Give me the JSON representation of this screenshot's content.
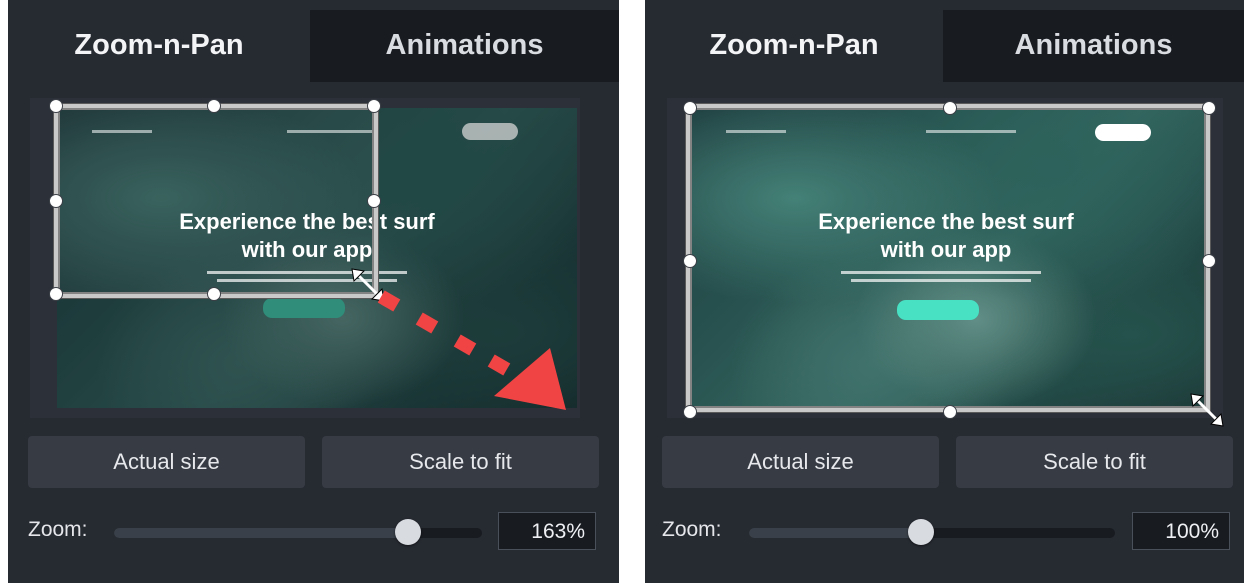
{
  "panels": [
    {
      "tabs": [
        {
          "label": "Zoom-n-Pan"
        },
        {
          "label": "Animations"
        }
      ],
      "preview": {
        "headline_line1": "Experience the best surf",
        "headline_line2": "with our app"
      },
      "buttons": {
        "actual_size": "Actual size",
        "scale_to_fit": "Scale to fit"
      },
      "zoom": {
        "label": "Zoom:",
        "value": "163%",
        "fraction": 0.8
      }
    },
    {
      "tabs": [
        {
          "label": "Zoom-n-Pan"
        },
        {
          "label": "Animations"
        }
      ],
      "preview": {
        "headline_line1": "Experience the best surf",
        "headline_line2": "with our app"
      },
      "buttons": {
        "actual_size": "Actual size",
        "scale_to_fit": "Scale to fit"
      },
      "zoom": {
        "label": "Zoom:",
        "value": "100%",
        "fraction": 0.47
      }
    }
  ],
  "colors": {
    "panel_bg": "#262a31",
    "inactive_tab_bg": "#181b20",
    "button_bg": "#363b44",
    "arrow_red": "#f04444",
    "cta_teal": "#41e0c2"
  },
  "icons": [
    "resize-diagonal-icon",
    "drag-direction-arrow-icon"
  ]
}
